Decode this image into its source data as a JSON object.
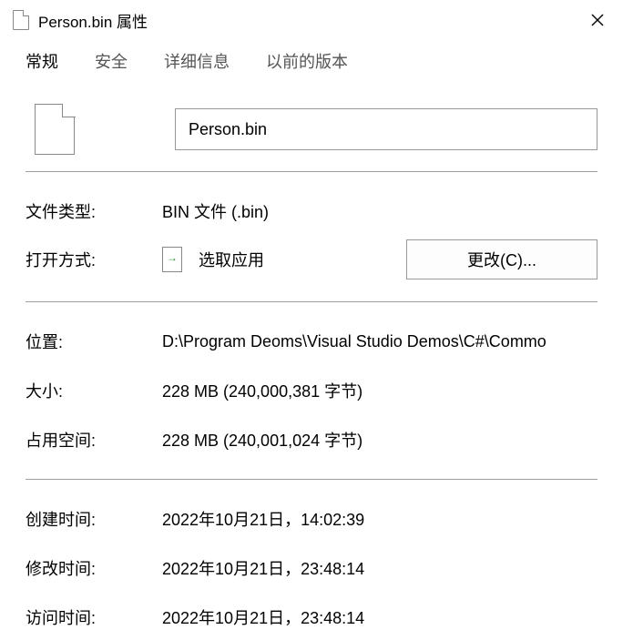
{
  "window": {
    "title": "Person.bin 属性"
  },
  "tabs": {
    "general": "常规",
    "security": "安全",
    "details": "详细信息",
    "previous": "以前的版本"
  },
  "general": {
    "filename": "Person.bin",
    "labels": {
      "filetype": "文件类型:",
      "opens_with": "打开方式:",
      "location": "位置:",
      "size": "大小:",
      "size_on_disk": "占用空间:",
      "created": "创建时间:",
      "modified": "修改时间:",
      "accessed": "访问时间:"
    },
    "values": {
      "filetype": "BIN 文件 (.bin)",
      "opens_with_app": "选取应用",
      "change_button": "更改(C)...",
      "location": "D:\\Program Deoms\\Visual Studio Demos\\C#\\Commo",
      "size": "228 MB (240,000,381 字节)",
      "size_on_disk": "228 MB (240,001,024 字节)",
      "created": "2022年10月21日，14:02:39",
      "modified": "2022年10月21日，23:48:14",
      "accessed": "2022年10月21日，23:48:14"
    }
  }
}
